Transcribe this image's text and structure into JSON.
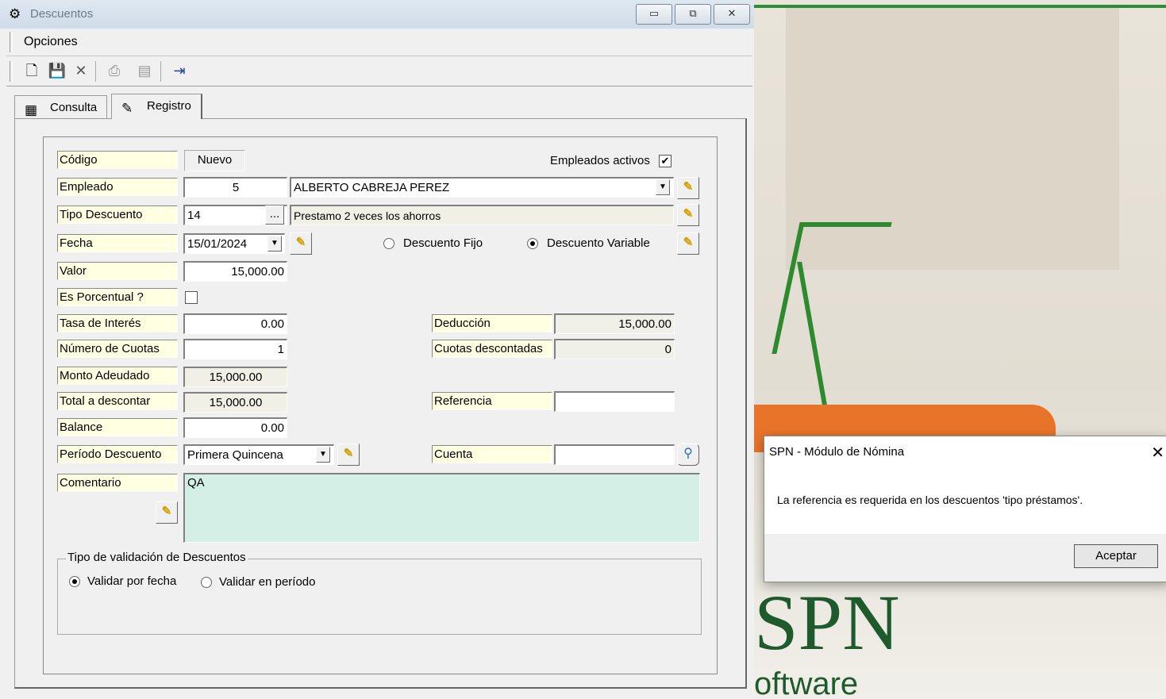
{
  "window": {
    "title": "Descuentos",
    "minimize": "▭",
    "maximize": "⧉",
    "close": "✕"
  },
  "menu": {
    "opciones": "Opciones"
  },
  "tabs": [
    {
      "label": "Consulta"
    },
    {
      "label": "Registro"
    }
  ],
  "form": {
    "codigo": {
      "label": "Código",
      "value": "Nuevo"
    },
    "empleados_activos": {
      "label": "Empleados activos",
      "checked": true
    },
    "empleado": {
      "label": "Empleado",
      "id": "5",
      "name": "ALBERTO CABREJA PEREZ"
    },
    "tipo_descuento": {
      "label": "Tipo Descuento",
      "code": "14",
      "description": "Prestamo  2 veces  los ahorros",
      "browse": "..."
    },
    "fecha": {
      "label": "Fecha",
      "value": "15/01/2024"
    },
    "descuento_fijo": {
      "label": "Descuento Fijo",
      "selected": false
    },
    "descuento_variable": {
      "label": "Descuento Variable",
      "selected": true
    },
    "valor": {
      "label": "Valor",
      "value": "15,000.00"
    },
    "es_porcentual": {
      "label": "Es Porcentual ?",
      "checked": false
    },
    "tasa_interes": {
      "label": "Tasa de Interés",
      "value": "0.00"
    },
    "numero_cuotas": {
      "label": "Número de Cuotas",
      "value": "1"
    },
    "monto_adeudado": {
      "label": "Monto Adeudado",
      "value": "15,000.00"
    },
    "total_descontar": {
      "label": "Total a descontar",
      "value": "15,000.00"
    },
    "balance": {
      "label": "Balance",
      "value": "0.00"
    },
    "periodo_descuento": {
      "label": "Período Descuento",
      "value": "Primera Quincena"
    },
    "deduccion": {
      "label": "Deducción",
      "value": "15,000.00"
    },
    "cuotas_descontadas": {
      "label": "Cuotas descontadas",
      "value": "0"
    },
    "referencia": {
      "label": "Referencia",
      "value": ""
    },
    "cuenta": {
      "label": "Cuenta",
      "value": ""
    },
    "comentario": {
      "label": "Comentario",
      "value": "QA"
    }
  },
  "validacion": {
    "legend": "Tipo de validación de Descuentos",
    "por_fecha": {
      "label": "Validar por fecha",
      "selected": true
    },
    "en_periodo": {
      "label": "Validar en período",
      "selected": false
    }
  },
  "dialog": {
    "title": "SPN - Módulo de Nómina",
    "message": "La referencia es requerida en los descuentos 'tipo préstamos'.",
    "button": "Aceptar",
    "close": "✕"
  },
  "background": {
    "brand": "SPN",
    "subtitle": "oftware"
  },
  "colors": {
    "label_bg": "#ffffe1",
    "comment_bg": "#d4efe6",
    "brand_green": "#1e5a2c"
  }
}
